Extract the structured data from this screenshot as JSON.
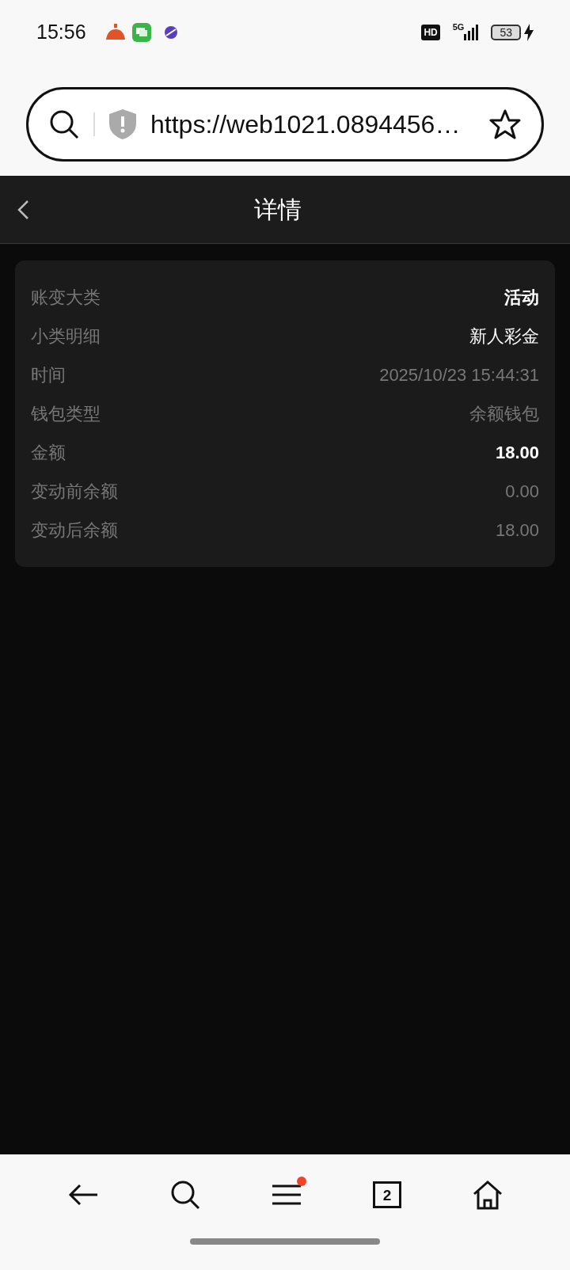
{
  "status_bar": {
    "time": "15:56",
    "network": "5G",
    "hd": "HD",
    "battery": "53",
    "charging": true
  },
  "url_bar": {
    "url": "https://web1021.0894456…"
  },
  "header": {
    "title": "详情"
  },
  "details": [
    {
      "label": "账变大类",
      "value": "活动",
      "emphasized": true,
      "dimmed": false
    },
    {
      "label": "小类明细",
      "value": "新人彩金",
      "emphasized": false,
      "dimmed": false
    },
    {
      "label": "时间",
      "value": "2025/10/23 15:44:31",
      "emphasized": false,
      "dimmed": true
    },
    {
      "label": "钱包类型",
      "value": "余额钱包",
      "emphasized": false,
      "dimmed": true
    },
    {
      "label": "金额",
      "value": "18.00",
      "emphasized": true,
      "dimmed": false
    },
    {
      "label": "变动前余额",
      "value": "0.00",
      "emphasized": false,
      "dimmed": true
    },
    {
      "label": "变动后余额",
      "value": "18.00",
      "emphasized": false,
      "dimmed": true
    }
  ],
  "bottom_nav": {
    "tab_count": "2",
    "menu_notification": true
  }
}
